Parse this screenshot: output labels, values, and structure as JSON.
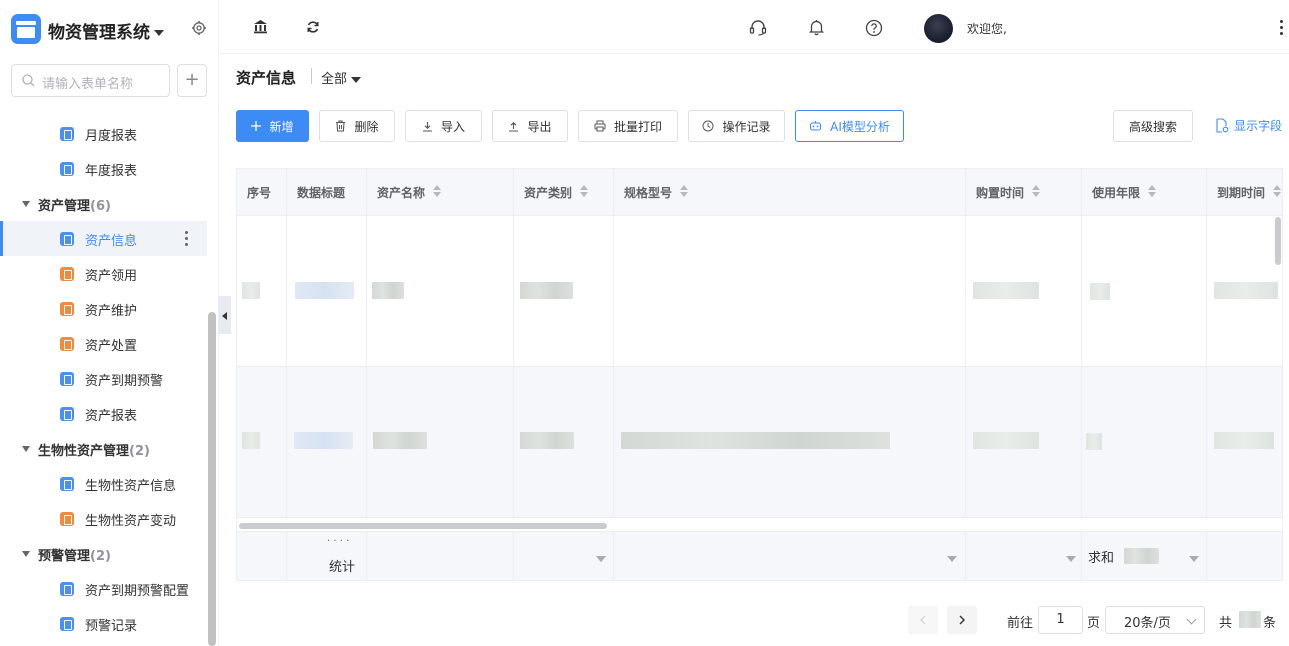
{
  "app": {
    "title": "物资管理系统"
  },
  "sidebar": {
    "search_placeholder": "请输入表单名称",
    "add_label": "+",
    "items": [
      {
        "label": "月度报表",
        "icon": "report-icon",
        "color": "blue"
      },
      {
        "label": "年度报表",
        "icon": "report-icon",
        "color": "blue"
      },
      {
        "group": "资产管理",
        "count": "(6)"
      },
      {
        "label": "资产信息",
        "icon": "form-icon",
        "color": "blue",
        "active": true
      },
      {
        "label": "资产领用",
        "icon": "flow-icon",
        "color": "orange"
      },
      {
        "label": "资产维护",
        "icon": "flow-icon",
        "color": "orange"
      },
      {
        "label": "资产处置",
        "icon": "flow-icon",
        "color": "orange"
      },
      {
        "label": "资产到期预警",
        "icon": "form-icon",
        "color": "blue"
      },
      {
        "label": "资产报表",
        "icon": "report-icon",
        "color": "blue"
      },
      {
        "group": "生物性资产管理",
        "count": "(2)"
      },
      {
        "label": "生物性资产信息",
        "icon": "form-icon",
        "color": "blue"
      },
      {
        "label": "生物性资产变动",
        "icon": "flow-icon",
        "color": "orange"
      },
      {
        "group": "预警管理",
        "count": "(2)"
      },
      {
        "label": "资产到期预警配置",
        "icon": "form-icon",
        "color": "blue"
      },
      {
        "label": "预警记录",
        "icon": "form-icon",
        "color": "blue"
      }
    ]
  },
  "topbar": {
    "welcome": "欢迎您,"
  },
  "page": {
    "title": "资产信息",
    "scope": "全部"
  },
  "toolbar": {
    "new": "新增",
    "delete": "删除",
    "import": "导入",
    "export": "导出",
    "batch_print": "批量打印",
    "log": "操作记录",
    "ai": "AI模型分析",
    "advanced_search": "高级搜索",
    "show_fields": "显示字段"
  },
  "table": {
    "columns": [
      "序号",
      "数据标题",
      "资产名称",
      "资产类别",
      "规格型号",
      "购置时间",
      "使用年限",
      "到期时间"
    ],
    "footer": {
      "dots": "· · · ·",
      "stat_label": "统计",
      "sum_label": "求和"
    }
  },
  "pagination": {
    "goto": "前往",
    "page": "1",
    "page_unit": "页",
    "page_size": "20条/页",
    "total_prefix": "共",
    "total_suffix": "条"
  },
  "colors": {
    "primary": "#3d8bf4",
    "orange": "#f08a3c"
  }
}
